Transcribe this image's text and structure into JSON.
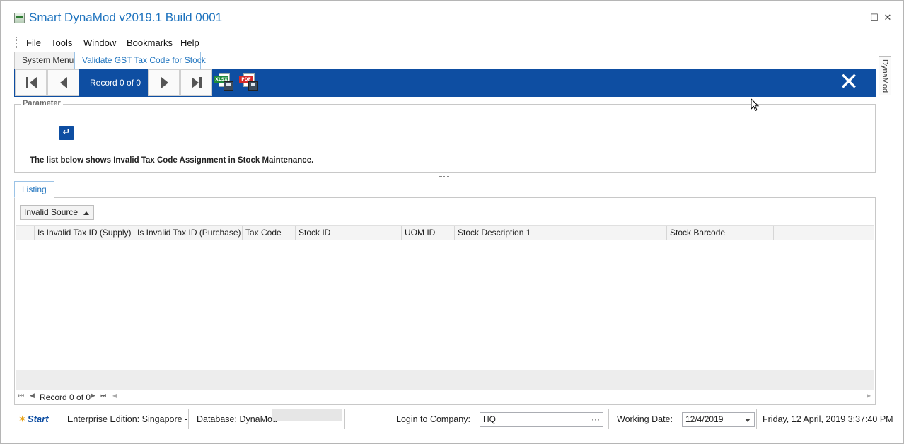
{
  "window": {
    "title": "Smart DynaMod v2019.1 Build 0001",
    "controls": {
      "minimize": "–",
      "maximize": "☐",
      "close": "✕"
    }
  },
  "menu": [
    "File",
    "Tools",
    "Window",
    "Bookmarks",
    "Help"
  ],
  "doc_tabs": [
    {
      "label": "System Menu",
      "active": false
    },
    {
      "label": "Validate GST Tax Code for Stock",
      "active": true
    }
  ],
  "side_tab": {
    "label": "DynaMod"
  },
  "toolbar": {
    "record_label": "Record 0 of 0",
    "export_xlsx_tag": "XLSX",
    "export_pdf_tag": "PDF",
    "icons": [
      "first-record-icon",
      "previous-record-icon",
      "next-record-icon",
      "last-record-icon",
      "export-xlsx-icon",
      "export-pdf-icon",
      "close-icon"
    ],
    "accent_color": "#0e4ea2"
  },
  "parameter": {
    "legend": "Parameter",
    "note": "The list below shows Invalid Tax Code Assignment in Stock Maintenance."
  },
  "listing": {
    "tab_label": "Listing",
    "group_by": "Invalid Source",
    "columns": [
      "Is Invalid Tax ID (Supply)",
      "Is Invalid Tax ID (Purchase)",
      "Tax Code",
      "Stock ID",
      "UOM ID",
      "Stock Description 1",
      "Stock Barcode"
    ],
    "rows": [],
    "pager_text": "Record 0 of 0"
  },
  "status": {
    "logo_text": "Start",
    "edition": "Enterprise Edition: Singapore -",
    "database": "Database: DynaMod",
    "login_label": "Login to Company:",
    "company": "HQ",
    "company_button": "···",
    "working_date_label": "Working Date:",
    "working_date": "12/4/2019",
    "clock": "Friday, 12 April, 2019 3:37:40 PM"
  }
}
